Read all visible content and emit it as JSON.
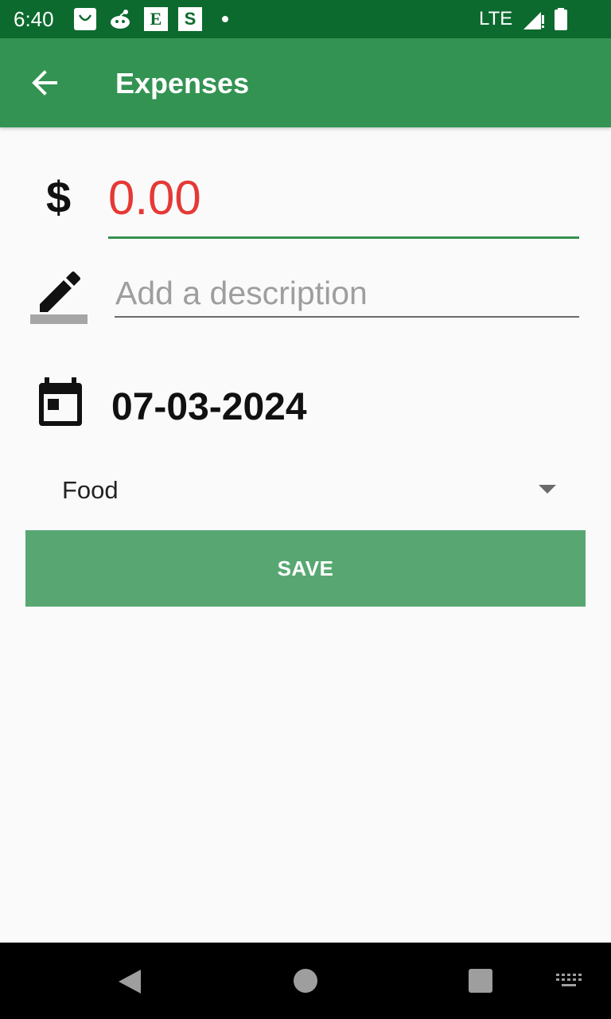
{
  "status_bar": {
    "time": "6:40",
    "notification_icons": [
      "shopping-bag-icon",
      "reddit-icon",
      "etsy-icon",
      "s-app-icon",
      "dot-icon"
    ],
    "e_letter": "E",
    "s_letter": "S",
    "network": "LTE"
  },
  "app_bar": {
    "title": "Expenses"
  },
  "form": {
    "currency_symbol": "$",
    "amount": "0.00",
    "description_placeholder": "Add a description",
    "date": "07-03-2024",
    "category": "Food",
    "save_label": "SAVE"
  },
  "colors": {
    "status_bar": "#0d6a2e",
    "app_bar": "#339352",
    "amount_text": "#e53935",
    "save_button": "#58a772"
  }
}
